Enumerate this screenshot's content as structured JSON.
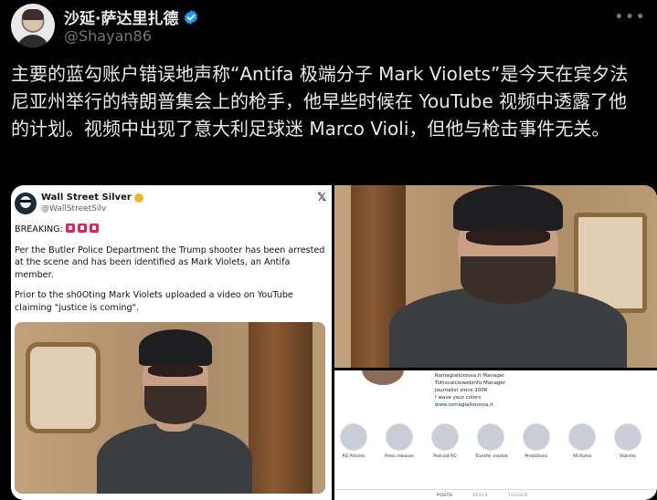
{
  "author": {
    "display_name": "沙延·萨达里扎德",
    "handle": "@Shayan86",
    "verified_icon": "verified-badge-icon",
    "more_icon": "more-options-icon"
  },
  "tweet": {
    "text": "主要的蓝勾账户错误地声称“Antifa 极端分子 Mark Violets”是今天在宾夕法尼亚州举行的特朗普集会上的枪手，他早些时候在 YouTube 视频中透露了他的计划。视频中出现了意大利足球迷 Marco Violi，但他与枪击事件无关。"
  },
  "embedded_tweet": {
    "name": "Wall Street Silver",
    "handle": "@WallStreetSilv",
    "breaking": "BREAKING:",
    "paragraph_1": "Per the Butler Police Department the Trump shooter has been arrested at the scene and has been identified as Mark Violets, an Antifa member.",
    "paragraph_2": "Prior to the sh0Oting Mark Violets uploaded a video on YouTube claiming \"justice is coming\"."
  },
  "instagram_profile": {
    "bio_lines": [
      "Romagiallorossa.it Manager",
      "Tuttocalciowebinfo Manager",
      "Journalist since 2006",
      "I wave your colors",
      "www.romagiallorossa.it"
    ],
    "highlights": [
      "RG Articles",
      "Press releases",
      "Podcast RG",
      "Transfer market",
      "Predictions",
      "AS Roma",
      "Violinho"
    ],
    "tabs": [
      "POSTS",
      "REELS",
      "TAGGED"
    ]
  },
  "colors": {
    "background": "#000000",
    "text_primary": "#e7e9ea",
    "text_secondary": "#71767b",
    "verified_blue": "#1d9bf0",
    "gold_badge": "#e8b923"
  }
}
